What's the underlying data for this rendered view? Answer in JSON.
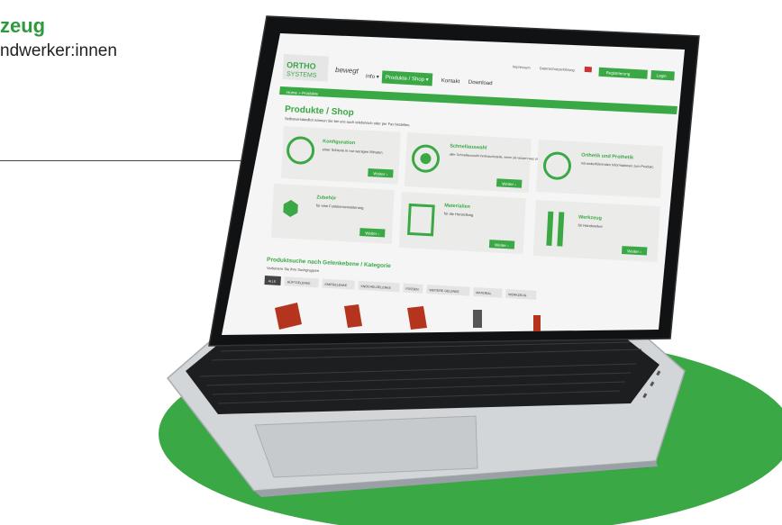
{
  "heading": {
    "title": "zeug",
    "subtitle": "ndwerker:innen"
  },
  "colors": {
    "brand_green": "#3aa845",
    "ellipse_green": "#3aa845",
    "dark_text": "#222222"
  },
  "laptop_screen": {
    "logo": {
      "line1": "ORTHO",
      "line2": "SYSTEMS",
      "tagline": "bewegt"
    },
    "top_links": [
      "Impressum",
      "Datenschutzerklärung"
    ],
    "top_buttons": [
      "Registrierung",
      "Login"
    ],
    "nav": [
      {
        "label": "Info",
        "active": false
      },
      {
        "label": "Produkte / Shop",
        "active": true
      },
      {
        "label": "Kontakt",
        "active": false
      },
      {
        "label": "Download",
        "active": false
      }
    ],
    "breadcrumb": "Home » Produkte",
    "page_title": "Produkte / Shop",
    "intro": "Selbstverständlich können Sie bei uns auch telefonisch oder per Fax bestellen.",
    "cards": [
      {
        "title": "Konfiguration",
        "text": "einer Schiene in nur wenigen Minuten.",
        "button": "Weiter",
        "icon": "stopwatch-icon"
      },
      {
        "title": "Schnellauswahl",
        "text": "aller Schnellauswahl-Verbrauchsteile, wenn sie wissen was sie benötigen.",
        "button": "Weiter",
        "icon": "target-icon"
      },
      {
        "title": "Orthetik und Prothetik",
        "text": "mit weiterführenden Informationen zum Produkt.",
        "button": "",
        "icon": "info-icon"
      },
      {
        "title": "Zubehör",
        "text": "für eine Funktionserweiterung.",
        "button": "Weiter",
        "icon": "hexagon-icon"
      },
      {
        "title": "Materialien",
        "text": "für die Herstellung.",
        "button": "Weiter",
        "icon": "materials-icon"
      },
      {
        "title": "Werkzeug",
        "text": "für Handwerker",
        "button": "Weiter",
        "icon": "tools-icon"
      }
    ],
    "section_title": "Produktsuche nach Gelenkebene / Kategorie",
    "section_sub": "Verfeinern Sie Ihre Suchgruppen",
    "filters": [
      "ALLE",
      "HÜFTGELENKE",
      "KNIEGELENKE",
      "KNÖCHELGELENKE",
      "FÜSSEN",
      "WEITERE GELENKE",
      "MATERIAL",
      "WERKZEUG"
    ]
  }
}
